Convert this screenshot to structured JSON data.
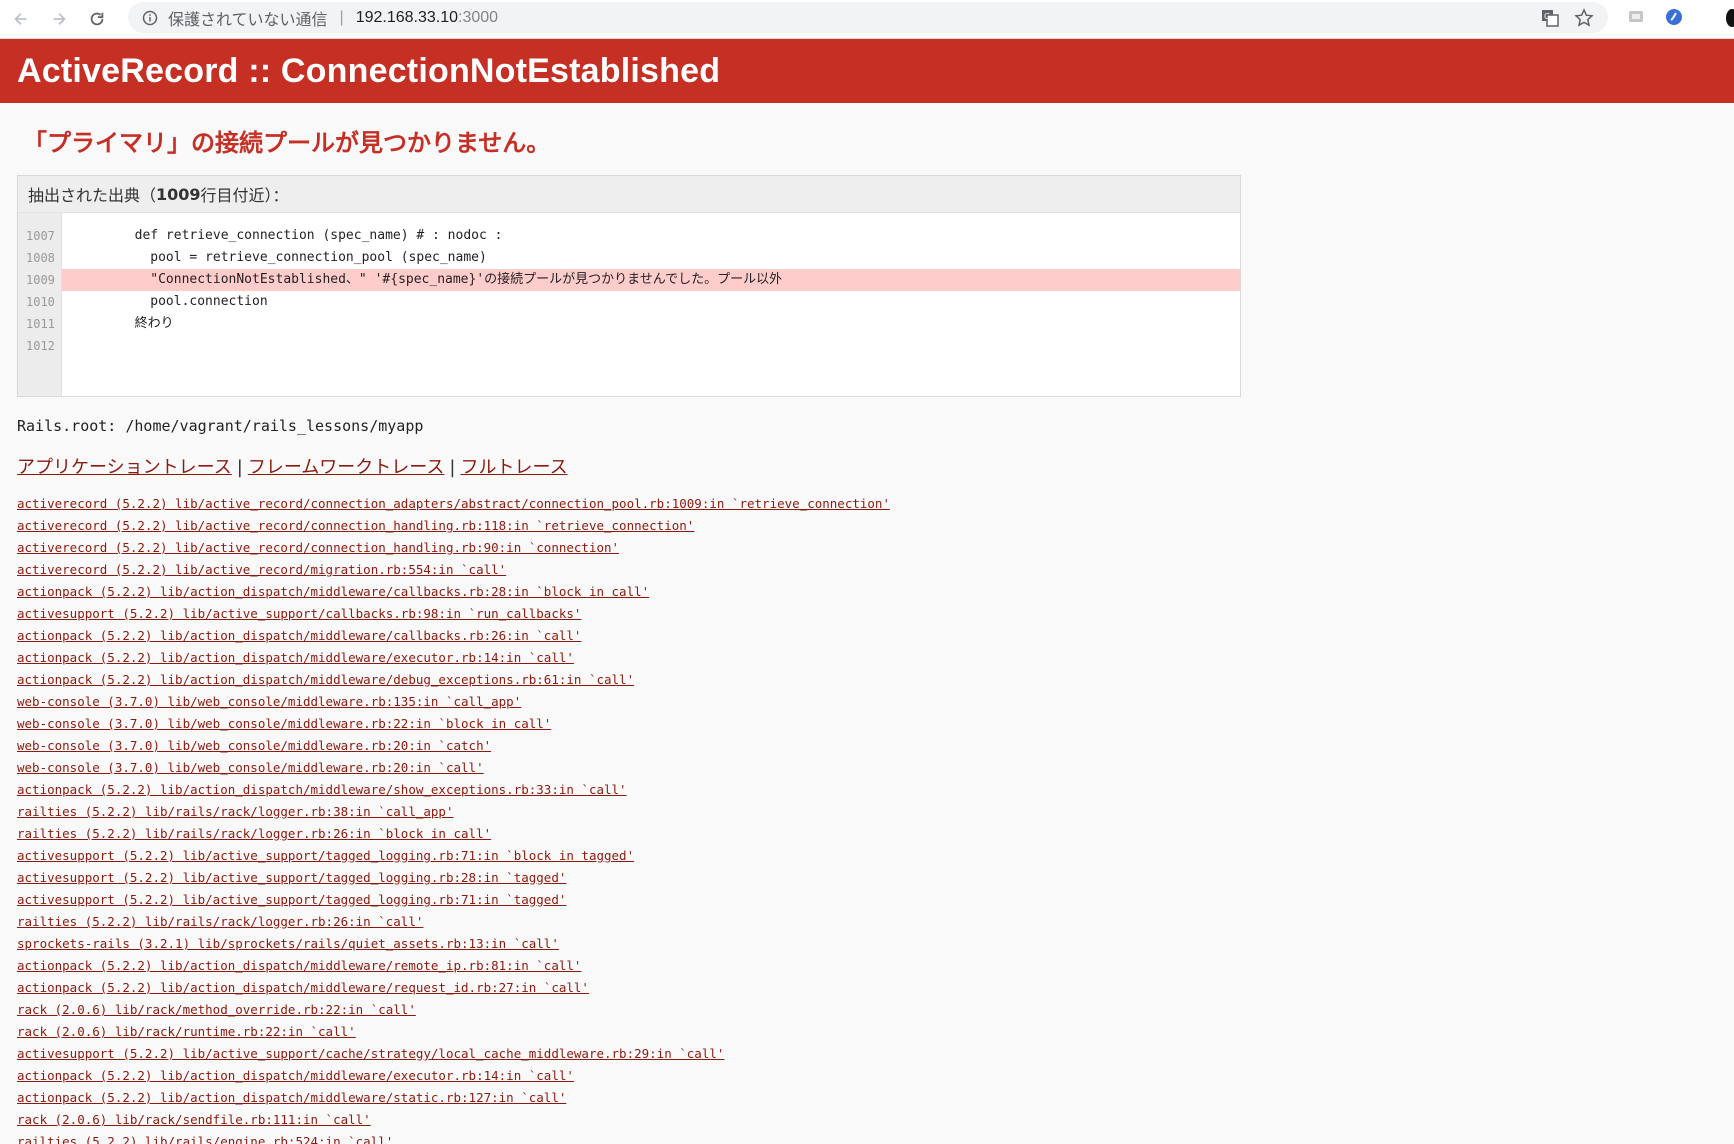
{
  "browser": {
    "security_text": "保護されていない通信",
    "separator": "|",
    "host": "192.168.33.10",
    "port": ":3000"
  },
  "error": {
    "title": "ActiveRecord :: ConnectionNotEstablished",
    "message": "「プライマリ」の接続プールが見つかりません。"
  },
  "source": {
    "header_prefix": "抽出された出典（",
    "header_line": "1009",
    "header_suffix": "行目付近）：",
    "line_numbers": [
      "1007",
      "1008",
      "1009",
      "1010",
      "1011",
      "1012"
    ],
    "lines": [
      "        def retrieve_connection (spec_name) # : nodoc :",
      "          pool = retrieve_connection_pool (spec_name)",
      "          \"ConnectionNotEstablished、\" '#{spec_name}'の接続プールが見つかりませんでした。プール以外",
      "          pool.connection",
      "        終わり",
      ""
    ]
  },
  "rails_root": "Rails.root: /home/vagrant/rails_lessons/myapp",
  "trace_tabs": {
    "application": "アプリケーショントレース",
    "framework": "フレームワークトレース",
    "full": "フルトレース",
    "separator": "|"
  },
  "trace": [
    "activerecord (5.2.2) lib/active_record/connection_adapters/abstract/connection_pool.rb:1009:in `retrieve_connection'",
    "activerecord (5.2.2) lib/active_record/connection_handling.rb:118:in `retrieve_connection'",
    "activerecord (5.2.2) lib/active_record/connection_handling.rb:90:in `connection'",
    "activerecord (5.2.2) lib/active_record/migration.rb:554:in `call'",
    "actionpack (5.2.2) lib/action_dispatch/middleware/callbacks.rb:28:in `block in call'",
    "activesupport (5.2.2) lib/active_support/callbacks.rb:98:in `run_callbacks'",
    "actionpack (5.2.2) lib/action_dispatch/middleware/callbacks.rb:26:in `call'",
    "actionpack (5.2.2) lib/action_dispatch/middleware/executor.rb:14:in `call'",
    "actionpack (5.2.2) lib/action_dispatch/middleware/debug_exceptions.rb:61:in `call'",
    "web-console (3.7.0) lib/web_console/middleware.rb:135:in `call_app'",
    "web-console (3.7.0) lib/web_console/middleware.rb:22:in `block in call'",
    "web-console (3.7.0) lib/web_console/middleware.rb:20:in `catch'",
    "web-console (3.7.0) lib/web_console/middleware.rb:20:in `call'",
    "actionpack (5.2.2) lib/action_dispatch/middleware/show_exceptions.rb:33:in `call'",
    "railties (5.2.2) lib/rails/rack/logger.rb:38:in `call_app'",
    "railties (5.2.2) lib/rails/rack/logger.rb:26:in `block in call'",
    "activesupport (5.2.2) lib/active_support/tagged_logging.rb:71:in `block in tagged'",
    "activesupport (5.2.2) lib/active_support/tagged_logging.rb:28:in `tagged'",
    "activesupport (5.2.2) lib/active_support/tagged_logging.rb:71:in `tagged'",
    "railties (5.2.2) lib/rails/rack/logger.rb:26:in `call'",
    "sprockets-rails (3.2.1) lib/sprockets/rails/quiet_assets.rb:13:in `call'",
    "actionpack (5.2.2) lib/action_dispatch/middleware/remote_ip.rb:81:in `call'",
    "actionpack (5.2.2) lib/action_dispatch/middleware/request_id.rb:27:in `call'",
    "rack (2.0.6) lib/rack/method_override.rb:22:in `call'",
    "rack (2.0.6) lib/rack/runtime.rb:22:in `call'",
    "activesupport (5.2.2) lib/active_support/cache/strategy/local_cache_middleware.rb:29:in `call'",
    "actionpack (5.2.2) lib/action_dispatch/middleware/executor.rb:14:in `call'",
    "actionpack (5.2.2) lib/action_dispatch/middleware/static.rb:127:in `call'",
    "rack (2.0.6) lib/rack/sendfile.rb:111:in `call'",
    "railties (5.2.2) lib/rails/engine.rb:524:in `call'"
  ],
  "icons": {
    "back": "arrow-left-icon",
    "forward": "arrow-right-icon",
    "reload": "reload-icon",
    "info": "info-icon",
    "translate": "translate-icon",
    "bookmark": "star-icon",
    "extension": "extension-icon",
    "profile": "profile-icon"
  },
  "colors": {
    "header_red": "#c52f24",
    "link": "#8b1a10",
    "highlight": "#ffcccc"
  }
}
